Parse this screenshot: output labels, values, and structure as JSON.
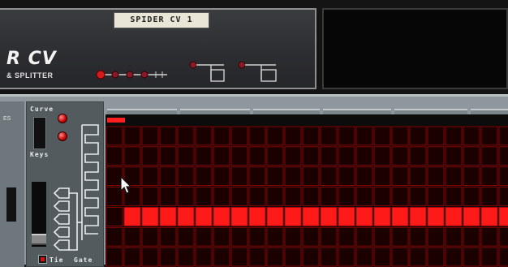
{
  "device": {
    "label_strip": "SPIDER CV 1",
    "brand_fragment": "R CV",
    "brand_sub": "& SPLITTER"
  },
  "sequencer": {
    "side_text": "ES",
    "labels": {
      "curve": "Curve",
      "keys": "Keys",
      "tie": "Tie",
      "gate": "Gate"
    },
    "steps": 24,
    "active_steps_start": 1,
    "row_count": 7,
    "active_row": 4,
    "colors": {
      "step_active": "#ff1a1a",
      "step_inactive": "#1b0000",
      "grid_line": "#a00000",
      "background": "#0c0c0c"
    }
  },
  "icons": {
    "cursor": "mouse-pointer-icon"
  }
}
